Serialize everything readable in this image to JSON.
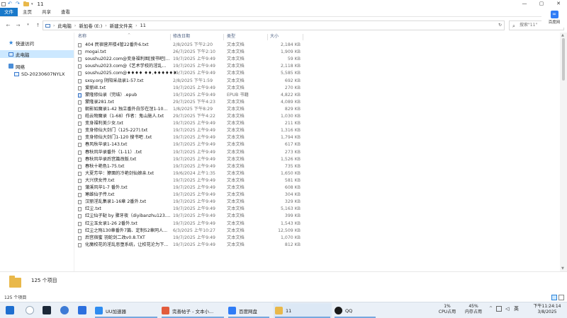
{
  "window": {
    "title": "11",
    "controls": {
      "minimize": "—",
      "maximize": "▢",
      "close": "✕"
    }
  },
  "ribbon": {
    "tabs": [
      "文件",
      "主页",
      "共享",
      "查看"
    ],
    "help_glyph": "?"
  },
  "baidu_panel": {
    "logo": "∞",
    "label": "百度网"
  },
  "address": {
    "segments": [
      "此电脑",
      "新加卷 (E:)",
      "新建文件夹",
      "11"
    ],
    "search_placeholder": "搜索\"11\""
  },
  "navigation": {
    "items": [
      {
        "label": "快速访问",
        "icon": "star-icon"
      },
      {
        "label": "此电脑",
        "icon": "pc-icon",
        "selected": true
      },
      {
        "label": "网络",
        "icon": "network-icon"
      },
      {
        "label": "SD-20230607NYLX",
        "icon": "computer-icon"
      }
    ]
  },
  "columns": {
    "name": "名称",
    "date": "修改日期",
    "type": "类型",
    "size": "大小"
  },
  "files": [
    {
      "name": "404 民宿营开楼4管22番外6.txt",
      "date": "2/8/2025 下午2:20",
      "type": "文本文档",
      "size": "2,184 KB"
    },
    {
      "name": "mogai.txt",
      "date": "26/7/2025 下午2:10",
      "type": "文本文档",
      "size": "1,909 KB"
    },
    {
      "name": "soushu2022.com@变身福利图[搜书吧]...",
      "date": "19/7/2025 上午9:49",
      "type": "文本文档",
      "size": "59 KB"
    },
    {
      "name": "soushu2023.com@《艺术学校的淫乱...",
      "date": "19/7/2025 上午9:49",
      "type": "文本文档",
      "size": "2,118 KB"
    },
    {
      "name": "soushu2025.com@♦♦♦♦ ♦♦,♦♦♦♦♦♦...",
      "date": "19/7/2025 上午9:49",
      "type": "文本文档",
      "size": "5,585 KB"
    },
    {
      "name": "sxsy.org 阴阳采战录1-57.txt",
      "date": "2/8/2025 下午1:59",
      "type": "文本文档",
      "size": "692 KB"
    },
    {
      "name": "爱丽丝.txt",
      "date": "19/7/2025 上午9:49",
      "type": "文本文档",
      "size": "270 KB"
    },
    {
      "name": "蒙隆修仙录（完结）.epub",
      "date": "19/7/2025 上午9:49",
      "type": "EPUB 书籍",
      "size": "4,822 KB"
    },
    {
      "name": "蒙隆录281.txt",
      "date": "29/7/2025 下午4:23",
      "type": "文本文档",
      "size": "4,089 KB"
    },
    {
      "name": "朝影如魔录1-42 独立番外白莎在涅1-10...",
      "date": "1/8/2025 下午8:29",
      "type": "文本文档",
      "size": "829 KB"
    },
    {
      "name": "皓云物魔录（1-68）作者：鬼山施人.txt",
      "date": "29/7/2025 下午4:22",
      "type": "文本文档",
      "size": "1,030 KB"
    },
    {
      "name": "变身福利美少女.txt",
      "date": "19/7/2025 上午9:49",
      "type": "文本文档",
      "size": "211 KB"
    },
    {
      "name": "变身修仙大剑门（125-227).txt",
      "date": "19/7/2025 上午9:49",
      "type": "文本文档",
      "size": "1,316 KB"
    },
    {
      "name": "变身修仙大剑门1-120 搜书吧 .txt",
      "date": "19/7/2025 上午9:49",
      "type": "文本文档",
      "size": "1,794 KB"
    },
    {
      "name": "春风秋华录1-143.txt",
      "date": "19/7/2025 上午9:49",
      "type": "文本文档",
      "size": "617 KB"
    },
    {
      "name": "春秋风华录番外（1-11）.txt",
      "date": "19/7/2025 上午9:49",
      "type": "文本文档",
      "size": "273 KB"
    },
    {
      "name": "春秋风华录后宫篇改版.txt",
      "date": "19/7/2025 上午9:49",
      "type": "文本文档",
      "size": "1,526 KB"
    },
    {
      "name": "春秋十艳色1-75.txt",
      "date": "19/7/2025 上午9:49",
      "type": "文本文档",
      "size": "735 KB"
    },
    {
      "name": "大夏芳华：獠面的冷艳剑仙娘亲.txt",
      "date": "19/6/2024 上午1:35",
      "type": "文本文档",
      "size": "1,650 KB"
    },
    {
      "name": "大兴侠女传.txt",
      "date": "19/7/2025 上午9:49",
      "type": "文本文档",
      "size": "581 KB"
    },
    {
      "name": "蒲溪风华1-7 番外.txt",
      "date": "19/7/2025 上午9:49",
      "type": "文本文档",
      "size": "608 KB"
    },
    {
      "name": "寒雌仙子传.txt",
      "date": "19/7/2025 上午9:49",
      "type": "文本文档",
      "size": "304 KB"
    },
    {
      "name": "汉丽淫乱集录1-16章 2番外.txt",
      "date": "19/7/2025 上午9:49",
      "type": "文本文档",
      "size": "329 KB"
    },
    {
      "name": "红尘.txt",
      "date": "19/7/2025 上午9:49",
      "type": "文本文档",
      "size": "5,163 KB"
    },
    {
      "name": "红尘仙子鞑 by 骤牙夜（diyibanzhu123....",
      "date": "19/7/2025 上午9:49",
      "type": "文本文档",
      "size": "399 KB"
    },
    {
      "name": "红尘玉女录1-26 2番外.txt",
      "date": "19/7/2025 上午9:49",
      "type": "文本文档",
      "size": "1,543 KB"
    },
    {
      "name": "红尘之殇130章番外7篇、定制52章同人...",
      "date": "6/3/2025 上午10:27",
      "type": "文本文档",
      "size": "12,509 KB"
    },
    {
      "name": "后宫宿蜜 羽蛇剑二改v0.8.TXT",
      "date": "19/7/2025 上午9:49",
      "type": "文本文档",
      "size": "1,070 KB"
    },
    {
      "name": "化魔校花的淫乱恶堕系统，让校花沦为下...",
      "date": "19/7/2025 上午9:49",
      "type": "文本文档",
      "size": "812 KB"
    }
  ],
  "details": {
    "count": "125 个项目"
  },
  "statusbar": {
    "count": "125 个项目"
  },
  "taskbar": {
    "apps": [
      {
        "label": "UU加速器",
        "color": "#2d8cf0"
      },
      {
        "label": "完善帖子 - 文本小...",
        "color": "#e25c3c"
      },
      {
        "label": "百度网盘",
        "color": "#2f7cf6"
      },
      {
        "label": "11",
        "color": "#e9b84a"
      },
      {
        "label": "QQ",
        "color": "#1a1a1a"
      }
    ],
    "cpu": {
      "value": "1%",
      "label": "CPU占用"
    },
    "mem": {
      "value": "45%",
      "label": "内存占用"
    },
    "lang": "英",
    "time": "下午11:24:14",
    "date": "3/8/2025"
  }
}
